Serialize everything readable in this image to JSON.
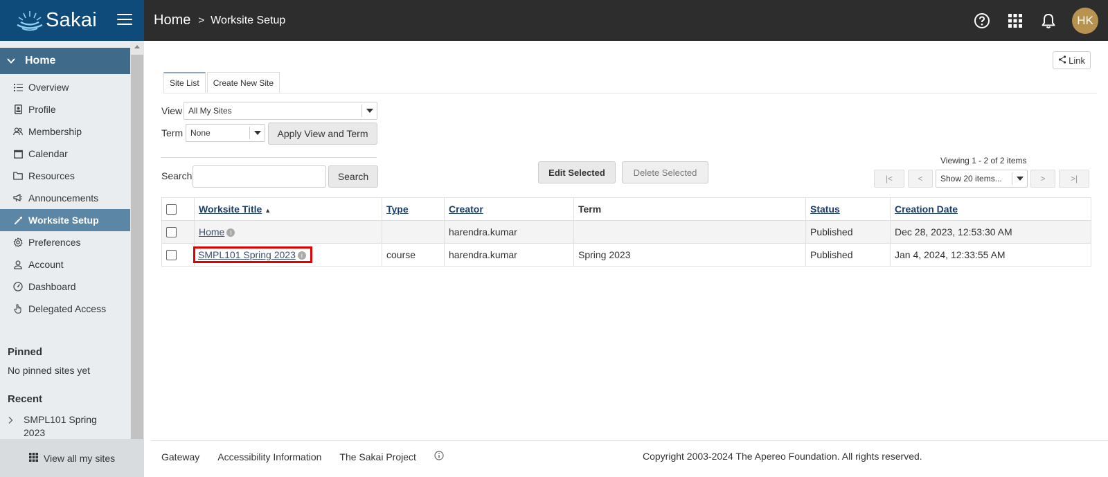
{
  "header": {
    "logo_text": "Sakai",
    "breadcrumb_home": "Home",
    "breadcrumb_sep": ">",
    "breadcrumb_page": "Worksite Setup",
    "avatar_initials": "HK",
    "icons": [
      "help-icon",
      "apps-grid-icon",
      "bell-icon"
    ]
  },
  "sidebar": {
    "site_title": "Home",
    "items": [
      {
        "label": "Overview",
        "icon": "list-icon"
      },
      {
        "label": "Profile",
        "icon": "profile-icon"
      },
      {
        "label": "Membership",
        "icon": "users-icon"
      },
      {
        "label": "Calendar",
        "icon": "calendar-icon"
      },
      {
        "label": "Resources",
        "icon": "folder-icon"
      },
      {
        "label": "Announcements",
        "icon": "megaphone-icon"
      },
      {
        "label": "Worksite Setup",
        "icon": "wrench-icon",
        "active": true
      },
      {
        "label": "Preferences",
        "icon": "gear-icon"
      },
      {
        "label": "Account",
        "icon": "person-icon"
      },
      {
        "label": "Dashboard",
        "icon": "gauge-icon"
      },
      {
        "label": "Delegated Access",
        "icon": "hand-icon"
      }
    ],
    "pinned_title": "Pinned",
    "pinned_empty": "No pinned sites yet",
    "recent_title": "Recent",
    "recent_item": "SMPL101 Spring 2023",
    "view_all": "View all my sites"
  },
  "main": {
    "link_button": "Link",
    "tabs": [
      {
        "label": "Site List",
        "active": true
      },
      {
        "label": "Create New Site",
        "active": false
      }
    ],
    "view_label": "View",
    "view_value": "All My Sites",
    "term_label": "Term",
    "term_value": "None",
    "apply_button": "Apply View and Term",
    "search_label": "Search",
    "search_value": "",
    "search_button": "Search",
    "edit_selected": "Edit Selected",
    "delete_selected": "Delete Selected",
    "viewing_text": "Viewing 1 - 2 of 2 items",
    "pager": {
      "first": "|<",
      "prev": "<",
      "show_value": "Show 20 items...",
      "next": ">",
      "last": ">|"
    },
    "table": {
      "headers": [
        "Worksite Title",
        "Type",
        "Creator",
        "Term",
        "Status",
        "Creation Date"
      ],
      "rows": [
        {
          "title": "Home",
          "type": "",
          "creator": "harendra.kumar",
          "term": "",
          "status": "Published",
          "created": "Dec 28, 2023, 12:53:30 AM"
        },
        {
          "title": "SMPL101 Spring 2023",
          "type": "course",
          "creator": "harendra.kumar",
          "term": "Spring 2023",
          "status": "Published",
          "created": "Jan 4, 2024, 12:33:55 AM"
        }
      ]
    }
  },
  "footer": {
    "links": [
      "Gateway",
      "Accessibility Information",
      "The Sakai Project"
    ],
    "copyright": "Copyright 2003-2024 The Apereo Foundation. All rights reserved."
  },
  "colors": {
    "logo_bg": "#0f4b7a",
    "header_bg": "#2d2d2d",
    "active_nav": "#5b86a6",
    "site_head": "#3f6a8a",
    "avatar": "#b8924f",
    "highlight": "#e00000"
  }
}
